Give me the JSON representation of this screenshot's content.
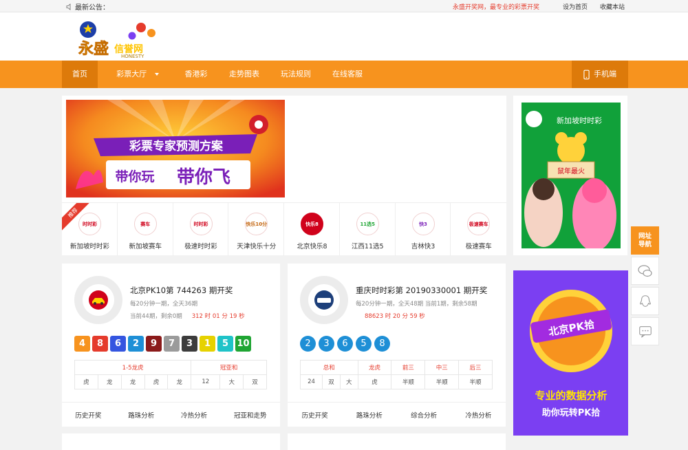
{
  "topbar": {
    "notice_label": "最新公告：",
    "marquee": "永盛开奖网，最专业的彩票开奖",
    "set_home": "设为首页",
    "bookmark": "收藏本站"
  },
  "logo": {
    "main": "永盛",
    "sub": "信誉网",
    "en": "HONESTY"
  },
  "nav": {
    "items": [
      {
        "label": "首页"
      },
      {
        "label": "彩票大厅"
      },
      {
        "label": "香港彩"
      },
      {
        "label": "走势图表"
      },
      {
        "label": "玩法规则"
      },
      {
        "label": "在线客服"
      }
    ],
    "mobile": "手机端"
  },
  "banner": {
    "line1": "彩票专家预测方案",
    "line2a": "带你玩",
    "line2b": "带你飞"
  },
  "recommend_badge": "推荐",
  "lotteries": [
    {
      "name": "新加坡时时彩",
      "icon_text": "时时彩"
    },
    {
      "name": "新加坡赛车",
      "icon_text": "赛车"
    },
    {
      "name": "极速时时彩",
      "icon_text": "时时彩"
    },
    {
      "name": "天津快乐十分",
      "icon_text": "快乐10分"
    },
    {
      "name": "北京快乐8",
      "icon_text": "快乐8"
    },
    {
      "name": "江西11选5",
      "icon_text": "11选5"
    },
    {
      "name": "吉林快3",
      "icon_text": "快3"
    },
    {
      "name": "极速赛车",
      "icon_text": "极速赛车"
    }
  ],
  "side_ad1": {
    "title": "新加坡时时彩",
    "tag": "鼠年最火"
  },
  "side_ad2": {
    "badge": "北京PK拾",
    "line1": "专业的数据分析",
    "line2": "助你玩转PK拾"
  },
  "draw1": {
    "title": "北京PK10第 744263 期开奖",
    "sub1": "每20分钟一期，全天36期",
    "sub2": "当前44期，剩余0期",
    "countdown": "312 时 01 分 19 秒",
    "balls": [
      {
        "n": "4",
        "c": "#f7931e"
      },
      {
        "n": "8",
        "c": "#e53b2c"
      },
      {
        "n": "6",
        "c": "#3455e0"
      },
      {
        "n": "2",
        "c": "#1e8fd6"
      },
      {
        "n": "9",
        "c": "#8b1a1a"
      },
      {
        "n": "7",
        "c": "#9b9b9b"
      },
      {
        "n": "3",
        "c": "#3c3c3c"
      },
      {
        "n": "1",
        "c": "#e6d200"
      },
      {
        "n": "5",
        "c": "#1fc3c8"
      },
      {
        "n": "10",
        "c": "#1fa533"
      }
    ],
    "head": [
      "1-5龙虎",
      "冠亚和"
    ],
    "vals": [
      "虎",
      "龙",
      "龙",
      "虎",
      "龙",
      "12",
      "大",
      "双"
    ],
    "links": [
      "历史开奖",
      "路珠分析",
      "冷热分析",
      "冠亚和走势"
    ]
  },
  "draw2": {
    "title": "重庆时时彩第 20190330001 期开奖",
    "sub1": "每20分钟一期，全天48期 当前1期，剩余58期",
    "sub2": "88623 时 20 分 59 秒",
    "balls": [
      "2",
      "3",
      "6",
      "5",
      "8"
    ],
    "head": [
      "总和",
      "龙虎",
      "前三",
      "中三",
      "后三"
    ],
    "vals": [
      "24",
      "双",
      "大",
      "虎",
      "半顺",
      "半顺",
      "半顺"
    ],
    "links": [
      "历史开奖",
      "路珠分析",
      "综合分析",
      "冷热分析"
    ]
  },
  "float": {
    "nav_line1": "网址",
    "nav_line2": "导航"
  },
  "colors": {
    "accent": "#f7931e",
    "red": "#e53b2c",
    "blue": "#1e8fd6"
  }
}
